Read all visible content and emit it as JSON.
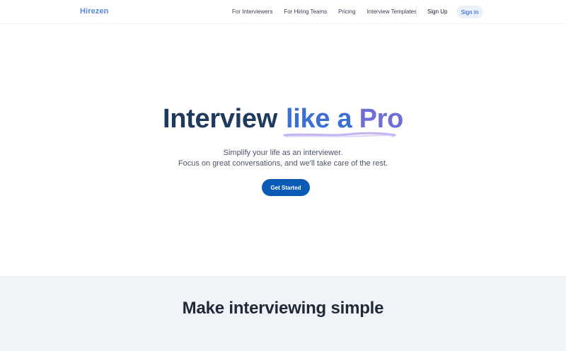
{
  "header": {
    "logo": "Hirezen",
    "nav": [
      {
        "label": "For Interviewers"
      },
      {
        "label": "For Hiring Teams"
      },
      {
        "label": "Pricing"
      },
      {
        "label": "Interview Templates"
      }
    ],
    "signup_label": "Sign Up",
    "signin_label": "Sign In"
  },
  "hero": {
    "title_part1": "Interview",
    "title_part2a": "like a",
    "title_part2b": "Pro",
    "subtitle_line1": "Simplify your life as an interviewer.",
    "subtitle_line2": "Focus on great conversations, and we'll take care of the rest.",
    "cta_label": "Get Started"
  },
  "section": {
    "title": "Make interviewing simple"
  },
  "colors": {
    "brand": "#5b86d6",
    "primary_button": "#0a5bb5",
    "title_dark": "#1e3a5f",
    "accent_blue": "#3b6fd1",
    "accent_violet": "#6d6fd6",
    "section_bg": "#f0f3f7"
  }
}
